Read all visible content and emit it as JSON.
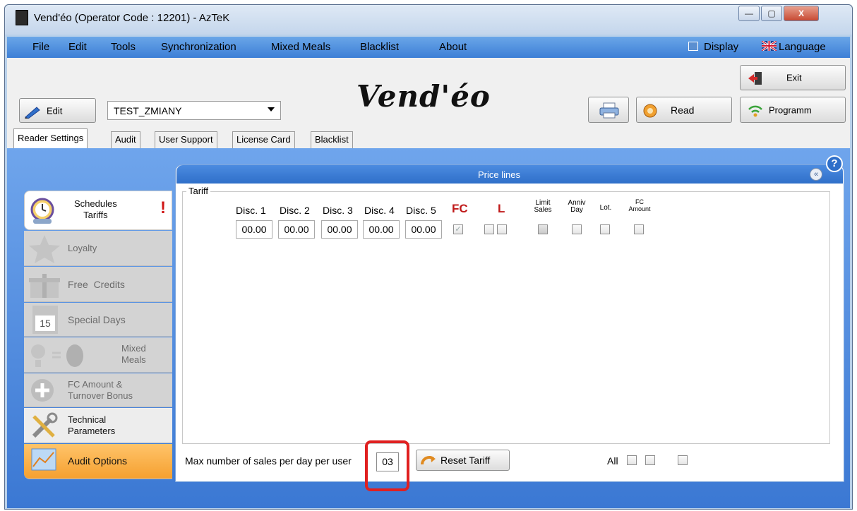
{
  "window": {
    "title": "Vend'éo (Operator Code : 12201) - AzTeK",
    "controls": [
      "—",
      "▢",
      "X"
    ]
  },
  "menu": {
    "items": [
      "File",
      "Edit",
      "Tools",
      "Synchronization",
      "Mixed Meals",
      "Blacklist",
      "About"
    ],
    "display": "Display",
    "language": "Language"
  },
  "toolbar": {
    "logo": "Vend'éo",
    "edit_label": "Edit",
    "combo_value": "TEST_ZMIANY",
    "read_label": "Read",
    "exit_label": "Exit",
    "programm_label": "Programm"
  },
  "tabs": [
    "Reader Settings",
    "Audit",
    "User Support",
    "License Card",
    "Blacklist"
  ],
  "sidebar": {
    "schedules": [
      "Schedules",
      "Tariffs"
    ],
    "alert": "!",
    "loyalty": "Loyalty",
    "free_credits": "Free  Credits",
    "special_days": "Special Days",
    "calendar_num": "15",
    "mixed_meals": [
      "Mixed",
      "Meals"
    ],
    "fc_amount": [
      "FC Amount &",
      "Turnover Bonus"
    ],
    "technical": [
      "Technical",
      "Parameters"
    ],
    "audit_options": "Audit Options"
  },
  "panel": {
    "title": "Price lines",
    "collapse_icon": "«",
    "help": "?",
    "tariff_legend": "Tariff",
    "disc_labels": [
      "Disc. 1",
      "Disc. 2",
      "Disc. 3",
      "Disc. 4",
      "Disc. 5"
    ],
    "disc_values": [
      "00.00",
      "00.00",
      "00.00",
      "00.00",
      "00.00"
    ],
    "fc_label": "FC",
    "l_label": "L",
    "limit_sales": [
      "Limit",
      "Sales"
    ],
    "anniv_day": [
      "Anniv",
      "Day"
    ],
    "lot": "Lot.",
    "fc_amount": [
      "FC",
      "Amount"
    ],
    "fc_checked": "✓"
  },
  "bottom": {
    "max_label": "Max number of sales per day per user",
    "max_value": "03",
    "reset_label": "Reset Tariff",
    "all_label": "All"
  }
}
